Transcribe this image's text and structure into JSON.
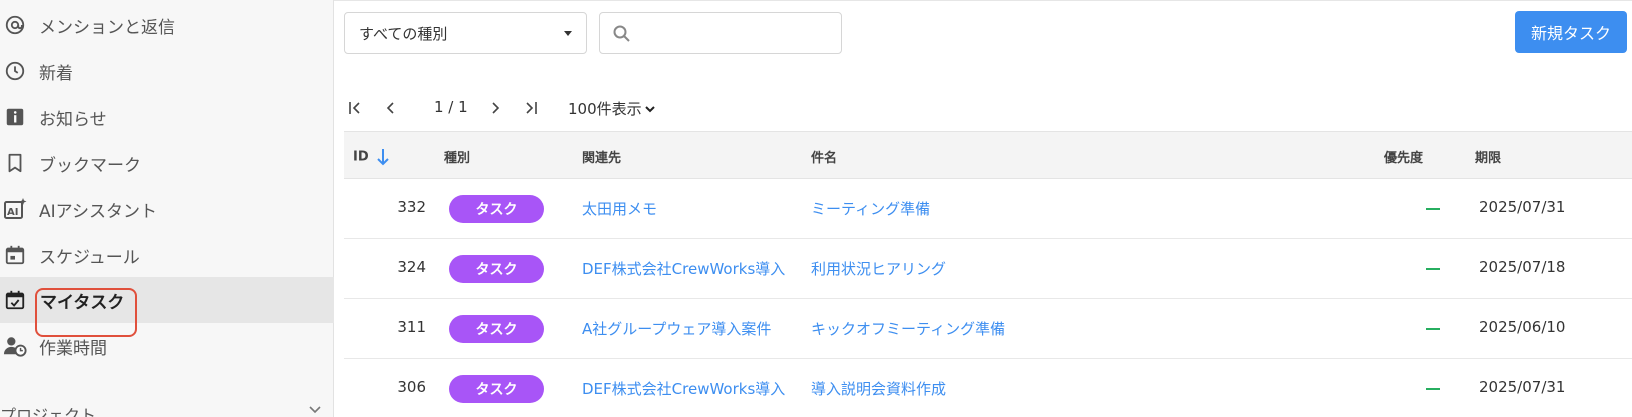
{
  "sidebar": {
    "items": [
      {
        "label": "メンションと返信"
      },
      {
        "label": "新着"
      },
      {
        "label": "お知らせ"
      },
      {
        "label": "ブックマーク"
      },
      {
        "label": "AIアシスタント"
      },
      {
        "label": "スケジュール"
      },
      {
        "label": "マイタスク"
      },
      {
        "label": "作業時間"
      }
    ],
    "section_label": "プロジェクト"
  },
  "toolbar": {
    "type_filter_value": "すべての種別",
    "search_placeholder": "",
    "new_task_label": "新規タスク"
  },
  "pager": {
    "page_text": "1 / 1",
    "per_page_label": "100件表示"
  },
  "table": {
    "headers": {
      "id": "ID",
      "type": "種別",
      "related": "関連先",
      "subject": "件名",
      "priority": "優先度",
      "due": "期限"
    },
    "rows": [
      {
        "id": "332",
        "type": "タスク",
        "related": "太田用メモ",
        "subject": "ミーティング準備",
        "due": "2025/07/31"
      },
      {
        "id": "324",
        "type": "タスク",
        "related": "DEF株式会社CrewWorks導入",
        "subject": "利用状況ヒアリング",
        "due": "2025/07/18"
      },
      {
        "id": "311",
        "type": "タスク",
        "related": "A社グループウェア導入案件",
        "subject": "キックオフミーティング準備",
        "due": "2025/06/10"
      },
      {
        "id": "306",
        "type": "タスク",
        "related": "DEF株式会社CrewWorks導入",
        "subject": "導入説明会資料作成",
        "due": "2025/07/31"
      }
    ]
  },
  "colors": {
    "accent": "#3d8ef0",
    "badge": "#a855f7",
    "priority_dash": "#27ae60",
    "highlight_ring": "#e0503c"
  }
}
